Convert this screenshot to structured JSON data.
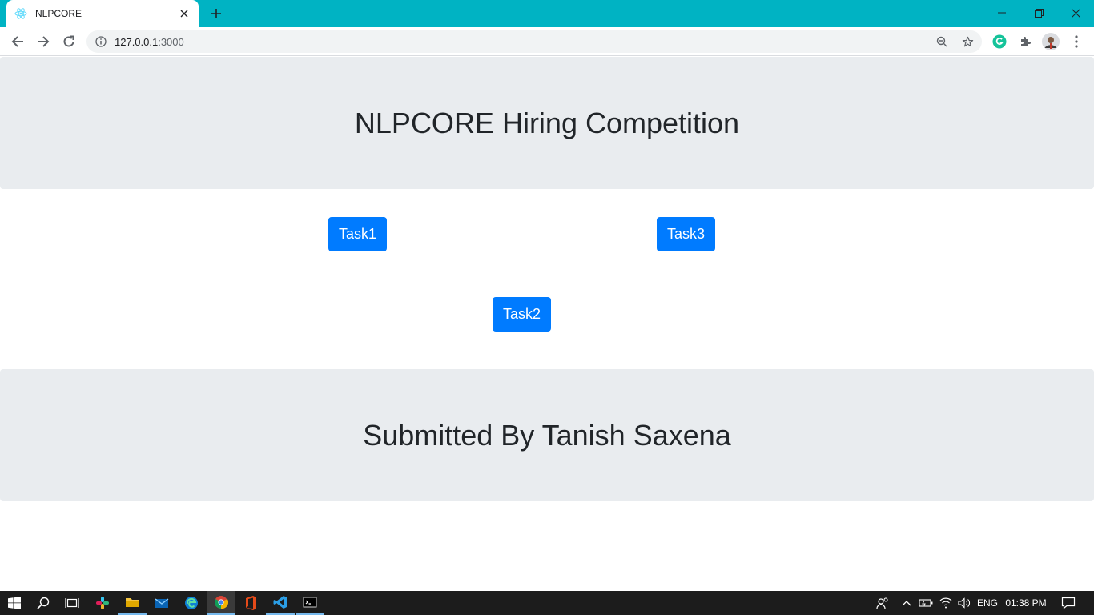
{
  "browser": {
    "tab_title": "NLPCORE",
    "url_host": "127.0.0.1",
    "url_port": ":3000",
    "colors": {
      "tab_strip": "#00b3c3",
      "toolbar": "#ffffff"
    }
  },
  "page": {
    "header_title": "NLPCORE Hiring Competition",
    "buttons": {
      "task1": "Task1",
      "task2": "Task2",
      "task3": "Task3"
    },
    "footer_title": "Submitted By Tanish Saxena",
    "colors": {
      "jumbotron": "#e9ecef",
      "button": "#007bff",
      "heading": "#212529"
    }
  },
  "taskbar": {
    "language": "ENG",
    "time": "01:38 PM",
    "apps": [
      "windows-start",
      "search",
      "task-view",
      "slack",
      "file-explorer",
      "mail",
      "edge",
      "chrome",
      "office",
      "vscode",
      "terminal"
    ]
  }
}
